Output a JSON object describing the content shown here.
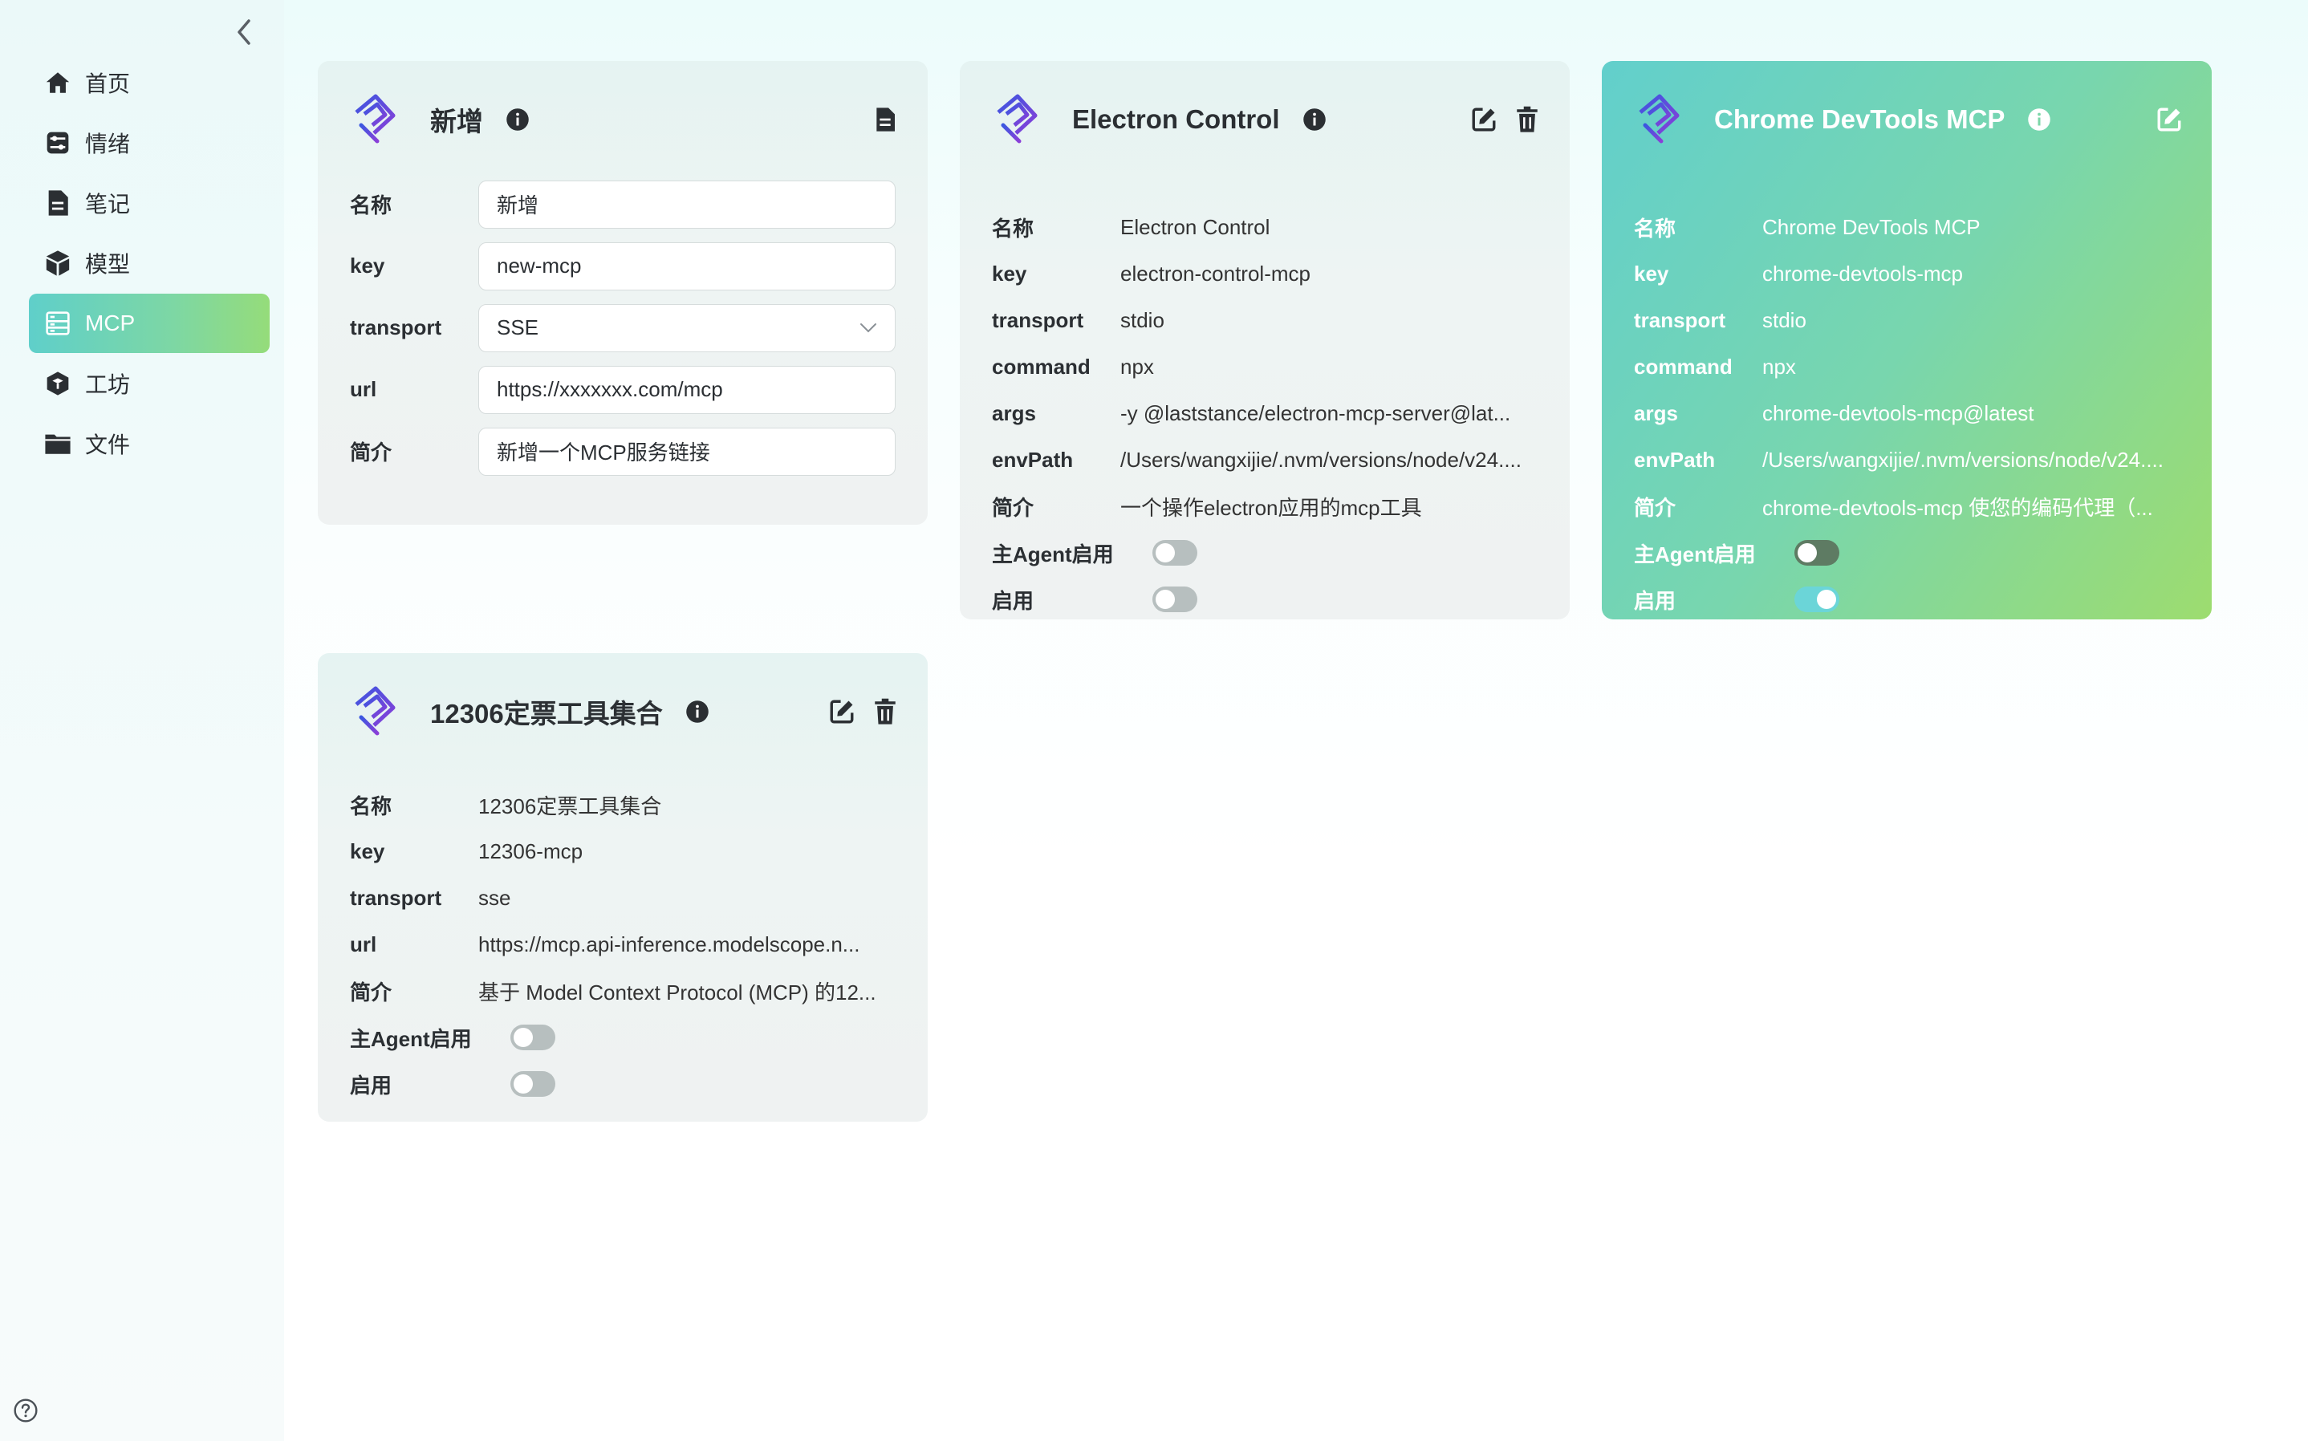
{
  "sidebar": {
    "items": [
      {
        "label": "首页",
        "icon": "home-icon"
      },
      {
        "label": "情绪",
        "icon": "sliders-icon"
      },
      {
        "label": "笔记",
        "icon": "note-icon"
      },
      {
        "label": "模型",
        "icon": "cube-icon"
      },
      {
        "label": "MCP",
        "icon": "server-icon"
      },
      {
        "label": "工坊",
        "icon": "box-icon"
      },
      {
        "label": "文件",
        "icon": "folder-icon"
      }
    ],
    "active": "MCP"
  },
  "new_card": {
    "title": "新增",
    "fields": [
      {
        "label": "名称",
        "value": "新增"
      },
      {
        "label": "key",
        "value": "new-mcp"
      },
      {
        "label": "transport",
        "value": "SSE"
      },
      {
        "label": "url",
        "value": "https://xxxxxxx.com/mcp"
      },
      {
        "label": "简介",
        "value": "新增一个MCP服务链接"
      }
    ]
  },
  "electron_card": {
    "title": "Electron Control",
    "fields": [
      {
        "label": "名称",
        "value": "Electron Control"
      },
      {
        "label": "key",
        "value": "electron-control-mcp"
      },
      {
        "label": "transport",
        "value": "stdio"
      },
      {
        "label": "command",
        "value": "npx"
      },
      {
        "label": "args",
        "value": "-y @laststance/electron-mcp-server@lat..."
      },
      {
        "label": "envPath",
        "value": "/Users/wangxijie/.nvm/versions/node/v24...."
      },
      {
        "label": "简介",
        "value": "一个操作electron应用的mcp工具"
      }
    ],
    "toggles": [
      {
        "label": "主Agent启用",
        "on": false
      },
      {
        "label": "启用",
        "on": false
      }
    ]
  },
  "chrome_card": {
    "title": "Chrome DevTools MCP",
    "fields": [
      {
        "label": "名称",
        "value": "Chrome DevTools MCP"
      },
      {
        "label": "key",
        "value": "chrome-devtools-mcp"
      },
      {
        "label": "transport",
        "value": "stdio"
      },
      {
        "label": "command",
        "value": "npx"
      },
      {
        "label": "args",
        "value": "chrome-devtools-mcp@latest"
      },
      {
        "label": "envPath",
        "value": "/Users/wangxijie/.nvm/versions/node/v24...."
      },
      {
        "label": "简介",
        "value": "chrome-devtools-mcp 使您的编码代理（..."
      }
    ],
    "toggles": [
      {
        "label": "主Agent启用",
        "on": false
      },
      {
        "label": "启用",
        "on": true
      }
    ]
  },
  "ticket_card": {
    "title": "12306定票工具集合",
    "fields": [
      {
        "label": "名称",
        "value": "12306定票工具集合"
      },
      {
        "label": "key",
        "value": "12306-mcp"
      },
      {
        "label": "transport",
        "value": "sse"
      },
      {
        "label": "url",
        "value": "https://mcp.api-inference.modelscope.n..."
      },
      {
        "label": "简介",
        "value": "基于 Model Context Protocol (MCP) 的12..."
      }
    ],
    "toggles": [
      {
        "label": "主Agent启用",
        "on": false
      },
      {
        "label": "启用",
        "on": false
      }
    ]
  },
  "colors": {
    "accent_start": "#5fcfca",
    "accent_end": "#9ddc6f",
    "logo_blue": "#3b57e0",
    "logo_purple": "#8a3fd8"
  }
}
